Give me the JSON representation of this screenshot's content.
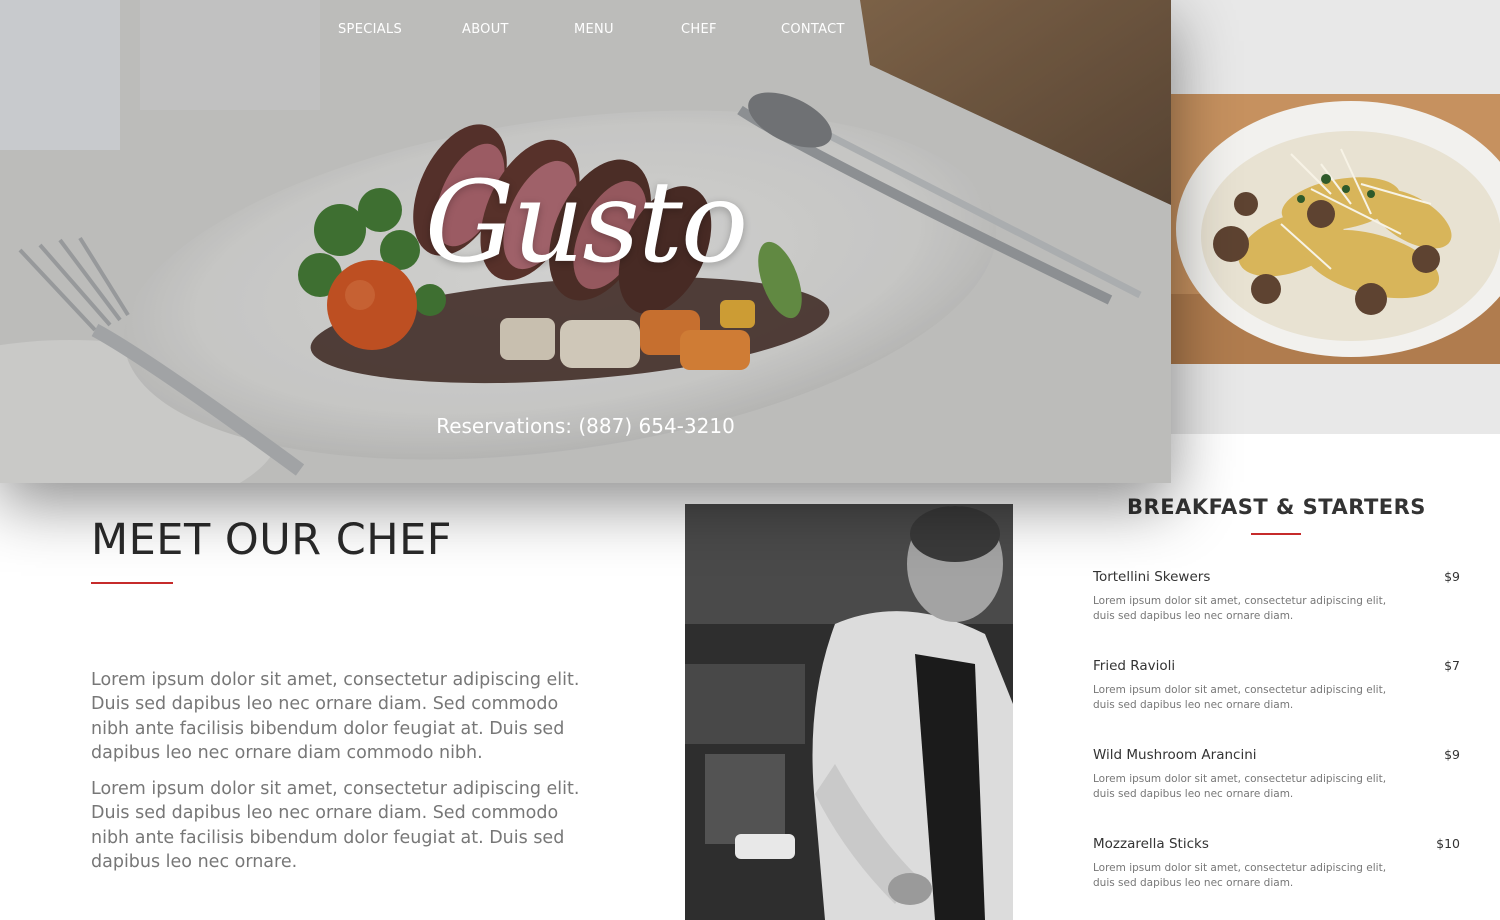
{
  "nav": {
    "items": [
      {
        "label": "SPECIALS"
      },
      {
        "label": "ABOUT"
      },
      {
        "label": "MENU"
      },
      {
        "label": "CHEF"
      },
      {
        "label": "CONTACT"
      }
    ]
  },
  "hero": {
    "logo": "Gusto",
    "reservations": "Reservations: (887) 654-3210"
  },
  "chef": {
    "title": "MEET OUR CHEF",
    "paragraphs": [
      "Lorem ipsum dolor sit amet, consectetur adipiscing elit. Duis sed dapibus leo nec ornare diam. Sed commodo nibh ante facilisis bibendum dolor feugiat at. Duis sed dapibus leo nec ornare diam commodo nibh.",
      "Lorem ipsum dolor sit amet, consectetur adipiscing elit. Duis sed dapibus leo nec ornare diam. Sed commodo nibh ante facilisis bibendum dolor feugiat at. Duis sed dapibus leo nec ornare."
    ]
  },
  "menu": {
    "title": "BREAKFAST & STARTERS",
    "items": [
      {
        "name": "Tortellini Skewers",
        "price": "$9",
        "description": "Lorem ipsum dolor sit amet, consectetur adipiscing elit, duis sed dapibus leo nec ornare diam."
      },
      {
        "name": "Fried Ravioli",
        "price": "$7",
        "description": "Lorem ipsum dolor sit amet, consectetur adipiscing elit, duis sed dapibus leo nec ornare diam."
      },
      {
        "name": "Wild Mushroom Arancini",
        "price": "$9",
        "description": "Lorem ipsum dolor sit amet, consectetur adipiscing elit, duis sed dapibus leo nec ornare diam."
      },
      {
        "name": "Mozzarella Sticks",
        "price": "$10",
        "description": "Lorem ipsum dolor sit amet, consectetur adipiscing elit, duis sed dapibus leo nec ornare diam."
      }
    ]
  },
  "colors": {
    "accent": "#c62b2b",
    "heading": "#2a2a2a",
    "body_text": "#777777"
  }
}
